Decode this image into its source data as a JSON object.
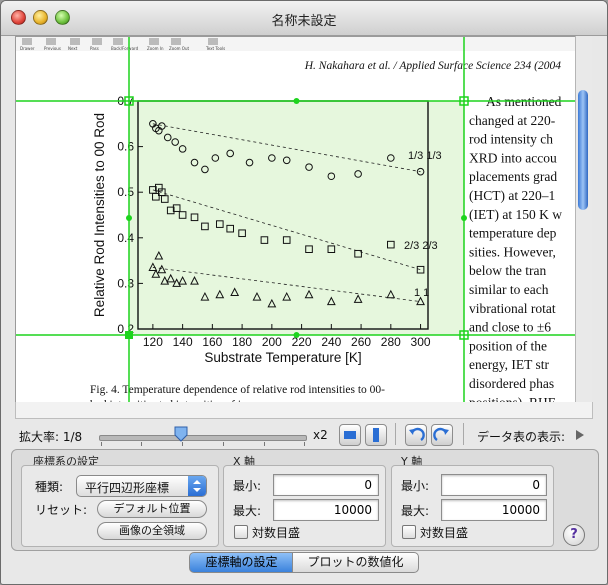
{
  "window": {
    "title": "名称未設定"
  },
  "document": {
    "running_head": "H. Nakahara et al. / Applied Surface Science 234 (2004",
    "toolbar_labels": [
      "Drawer",
      "Previous",
      "Next",
      "Pass",
      "Back/Forward",
      "Zoom In",
      "Zoom Out",
      "Text Tools"
    ],
    "right_text": [
      "As mentioned",
      "changed at 220-",
      "rod intensity ch",
      "XRD into accou",
      "placements grad",
      "(HCT) at 220–1",
      "(IET) at 150 K w",
      "temperature dep",
      "sities. However,",
      "below the tran",
      "similar to each",
      "vibrational rotat",
      "and close to ±6",
      "position of the ",
      "energy, IET str",
      "disordered phas",
      "positions). RHE"
    ],
    "caption": [
      "Fig. 4.  Temperature dependence of relative rod intensities to 00-",
      "bed intensities        ted intensities of    ing"
    ]
  },
  "chart_data": {
    "type": "scatter",
    "xlabel": "Substrate Temperature [K]",
    "ylabel": "Relative Rod Intensities to 00 Rod",
    "xlim": [
      110,
      305
    ],
    "ylim": [
      0.2,
      0.7
    ],
    "xticks": [
      120,
      140,
      160,
      180,
      200,
      220,
      240,
      260,
      280,
      300
    ],
    "yticks": [
      0.2,
      0.3,
      0.4,
      0.5,
      0.6,
      0.7
    ],
    "series": [
      {
        "name": "1/3 1/3",
        "marker": "circle",
        "x": [
          120,
          122,
          124,
          126,
          130,
          135,
          140,
          148,
          155,
          162,
          172,
          185,
          200,
          210,
          225,
          240,
          258,
          280,
          300
        ],
        "y": [
          0.65,
          0.64,
          0.635,
          0.645,
          0.62,
          0.61,
          0.595,
          0.565,
          0.55,
          0.575,
          0.585,
          0.565,
          0.575,
          0.57,
          0.555,
          0.535,
          0.54,
          0.575,
          0.545
        ]
      },
      {
        "name": "2/3 2/3",
        "marker": "square",
        "x": [
          120,
          122,
          124,
          126,
          128,
          132,
          136,
          140,
          148,
          155,
          165,
          172,
          180,
          195,
          210,
          225,
          240,
          258,
          280,
          300
        ],
        "y": [
          0.505,
          0.49,
          0.51,
          0.5,
          0.485,
          0.46,
          0.465,
          0.45,
          0.445,
          0.425,
          0.43,
          0.42,
          0.41,
          0.395,
          0.395,
          0.375,
          0.375,
          0.365,
          0.385,
          0.33
        ]
      },
      {
        "name": "1 1",
        "marker": "triangle",
        "x": [
          120,
          122,
          124,
          126,
          128,
          132,
          136,
          140,
          148,
          155,
          165,
          175,
          190,
          200,
          210,
          225,
          240,
          258,
          280,
          300
        ],
        "y": [
          0.335,
          0.32,
          0.36,
          0.33,
          0.305,
          0.31,
          0.3,
          0.305,
          0.305,
          0.27,
          0.275,
          0.28,
          0.27,
          0.255,
          0.27,
          0.275,
          0.26,
          0.265,
          0.275,
          0.26
        ]
      }
    ]
  },
  "zoom": {
    "label": "拡大率: 1/8",
    "max_label": "x2",
    "value_fraction": 0.4
  },
  "data_table_label": "データ表の表示:",
  "coords": {
    "group_title": "座標系の設定",
    "type_label": "種類:",
    "type_value": "平行四辺形座標",
    "reset_label": "リセット:",
    "default_pos": "デフォルト位置",
    "whole_image": "画像の全領域"
  },
  "x_axis": {
    "title": "X 軸",
    "min_label": "最小:",
    "min": "0",
    "max_label": "最大:",
    "max": "10000",
    "log_label": "対数目盛"
  },
  "y_axis": {
    "title": "Y 軸",
    "min_label": "最小:",
    "min": "0",
    "max_label": "最大:",
    "max": "10000",
    "log_label": "対数目盛"
  },
  "tabs": {
    "axis_settings": "座標軸の設定",
    "digitize": "プロットの数値化"
  },
  "colors": {
    "accent": "#3b82dc",
    "guide_green": "#1dd41d",
    "selection_fill": "#e6f7dd"
  }
}
